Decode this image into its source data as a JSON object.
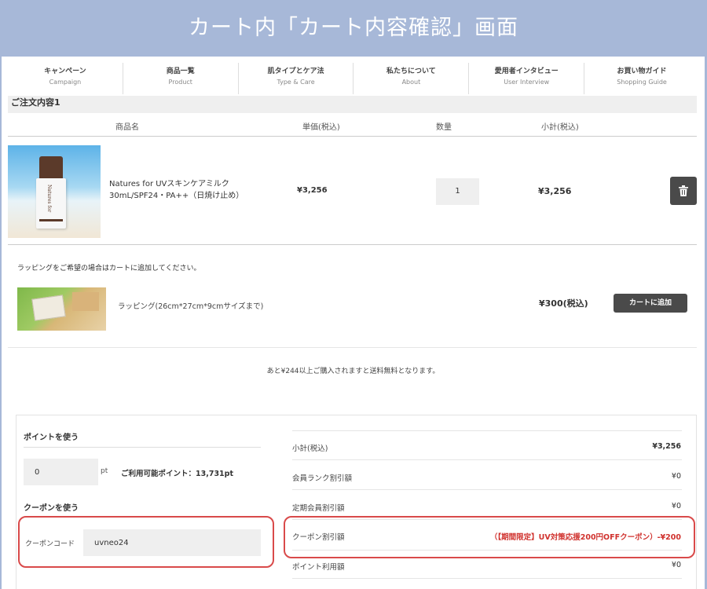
{
  "banner": {
    "title": "カート内「カート内容確認」画面"
  },
  "nav": {
    "items": [
      {
        "jp": "キャンペーン",
        "en": "Campaign"
      },
      {
        "jp": "商品一覧",
        "en": "Product"
      },
      {
        "jp": "肌タイプとケア法",
        "en": "Type & Care"
      },
      {
        "jp": "私たちについて",
        "en": "About"
      },
      {
        "jp": "愛用者インタビュー",
        "en": "User Interview"
      },
      {
        "jp": "お買い物ガイド",
        "en": "Shopping Guide"
      }
    ]
  },
  "order": {
    "section_title": "ご注文内容1",
    "headers": {
      "product": "商品名",
      "unit_price": "単価(税込)",
      "quantity": "数量",
      "subtotal": "小計(税込)"
    },
    "item": {
      "name": "Natures for UVスキンケアミルク 30mL/SPF24・PA++（日焼け止め）",
      "bottle_text": "Natures for",
      "unit_price": "¥3,256",
      "quantity": "1",
      "subtotal": "¥3,256"
    }
  },
  "wrapping": {
    "note": "ラッピングをご希望の場合はカートに追加してください。",
    "name": "ラッピング(26cm*27cm*9cmサイズまで)",
    "price": "¥300(税込)",
    "add_label": "カートに追加"
  },
  "shipping_note": "あと¥244以上ご購入されますと送料無料となります。",
  "points": {
    "title": "ポイントを使う",
    "value": "0",
    "unit": "pt",
    "available": "ご利用可能ポイント：13,731pt"
  },
  "coupon": {
    "title": "クーポンを使う",
    "label": "クーポンコード",
    "value": "uvneo24"
  },
  "summary": {
    "subtotal_label": "小計(税込)",
    "subtotal_value": "¥3,256",
    "rank_discount_label": "会員ランク割引額",
    "rank_discount_value": "¥0",
    "regular_discount_label": "定期会員割引額",
    "regular_discount_value": "¥0",
    "coupon_discount_label": "クーポン割引額",
    "coupon_discount_value": "（【期間限定】UV対策応援200円OFFクーポン）-¥200",
    "points_used_label": "ポイント利用額",
    "points_used_value": "¥0"
  },
  "colors": {
    "banner": "#a7b8d8",
    "highlight": "#d94a4a",
    "discount": "#d0312d",
    "button": "#4a4a4a"
  }
}
